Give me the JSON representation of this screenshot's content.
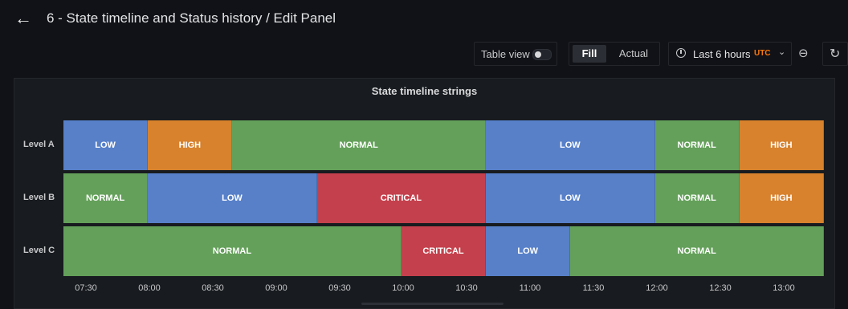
{
  "header": {
    "title": "6 - State timeline and Status history / Edit Panel",
    "back_icon": "arrow-left-icon"
  },
  "toolbar": {
    "table_view_label": "Table view",
    "table_view_enabled": false,
    "fill_label": "Fill",
    "actual_label": "Actual",
    "selected_mode": "Fill",
    "time_range_label": "Last 6 hours",
    "timezone_label": "UTC",
    "zoom_icon": "zoom-out-icon",
    "refresh_icon": "refresh-icon"
  },
  "panel": {
    "title": "State timeline strings"
  },
  "colors": {
    "LOW": "#5780c9",
    "HIGH": "#d8822d",
    "NORMAL": "#64a05a",
    "CRITICAL": "#c4404c",
    "accent": "#ff780a"
  },
  "chart_data": {
    "type": "state-timeline",
    "title": "State timeline strings",
    "rows": [
      {
        "name": "Level A",
        "segments": [
          {
            "state": "LOW",
            "start": "07:20",
            "end": "07:55"
          },
          {
            "state": "HIGH",
            "start": "07:55",
            "end": "08:30"
          },
          {
            "state": "NORMAL",
            "start": "08:30",
            "end": "10:15"
          },
          {
            "state": "LOW",
            "start": "10:15",
            "end": "11:25"
          },
          {
            "state": "NORMAL",
            "start": "11:25",
            "end": "12:00"
          },
          {
            "state": "HIGH",
            "start": "12:00",
            "end": "12:35"
          }
        ]
      },
      {
        "name": "Level B",
        "segments": [
          {
            "state": "NORMAL",
            "start": "07:20",
            "end": "07:55"
          },
          {
            "state": "LOW",
            "start": "07:55",
            "end": "09:05"
          },
          {
            "state": "CRITICAL",
            "start": "09:05",
            "end": "10:15"
          },
          {
            "state": "LOW",
            "start": "10:15",
            "end": "11:25"
          },
          {
            "state": "NORMAL",
            "start": "11:25",
            "end": "12:00"
          },
          {
            "state": "HIGH",
            "start": "12:00",
            "end": "12:35"
          }
        ]
      },
      {
        "name": "Level C",
        "segments": [
          {
            "state": "NORMAL",
            "start": "07:20",
            "end": "09:40"
          },
          {
            "state": "CRITICAL",
            "start": "09:40",
            "end": "10:15"
          },
          {
            "state": "LOW",
            "start": "10:15",
            "end": "10:50"
          },
          {
            "state": "NORMAL",
            "start": "10:50",
            "end": "12:35"
          }
        ]
      }
    ],
    "x_ticks": [
      "07:30",
      "08:00",
      "08:30",
      "09:00",
      "09:30",
      "10:00",
      "10:30",
      "11:00",
      "11:30",
      "12:00",
      "12:30",
      "13:00"
    ],
    "x_range": [
      "07:20",
      "12:35"
    ]
  }
}
